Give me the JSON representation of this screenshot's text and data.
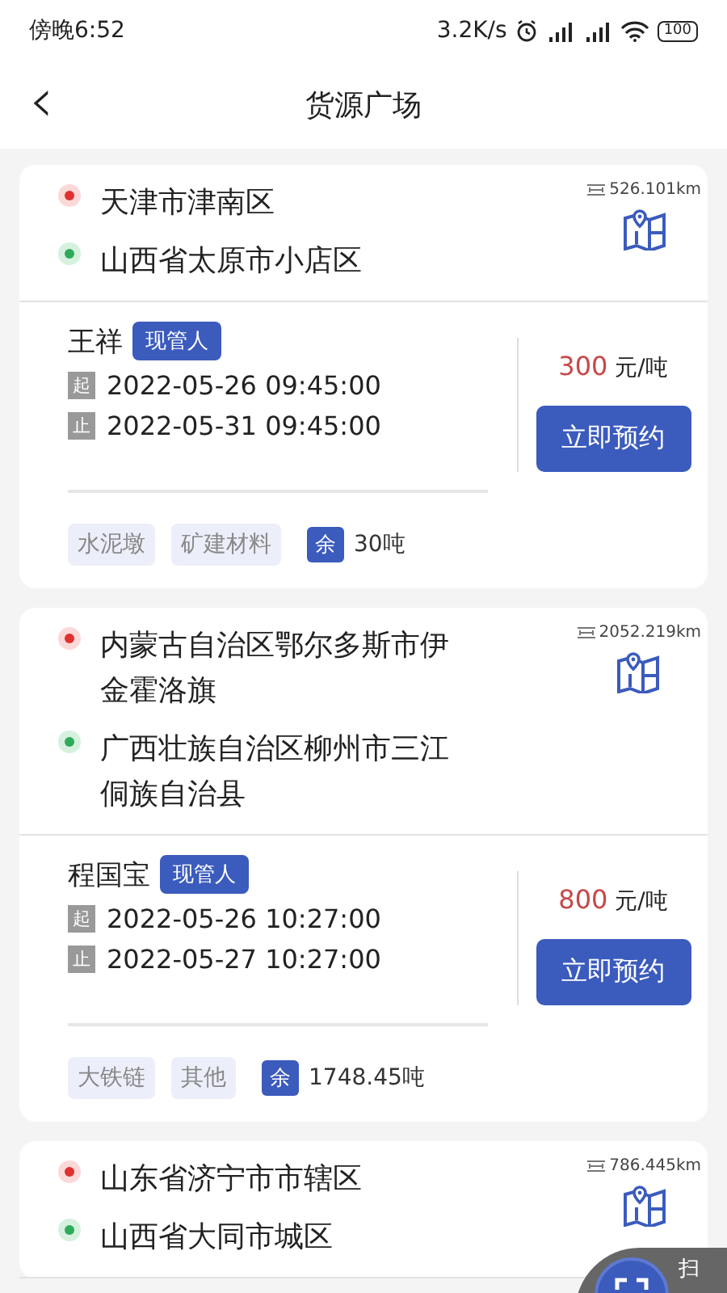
{
  "status_bar": {
    "time": "傍晚6:52",
    "speed": "3.2K/s",
    "battery": "100"
  },
  "header": {
    "back": "‹",
    "title": "货源广场"
  },
  "cards": [
    {
      "origin": "天津市津南区",
      "destination": "山西省太原市小店区",
      "distance": "526.101km",
      "name": "王祥",
      "role": "现管人",
      "start_label": "起",
      "start": "2022-05-26 09:45:00",
      "end_label": "止",
      "end": "2022-05-31 09:45:00",
      "price": "300",
      "price_unit": "元/吨",
      "button": "立即预约",
      "tags": [
        "水泥墩",
        "矿建材料"
      ],
      "remain_label": "余",
      "remain": "30吨"
    },
    {
      "origin": "内蒙古自治区鄂尔多斯市伊金霍洛旗",
      "destination": "广西壮族自治区柳州市三江侗族自治县",
      "distance": "2052.219km",
      "name": "程国宝",
      "role": "现管人",
      "start_label": "起",
      "start": "2022-05-26 10:27:00",
      "end_label": "止",
      "end": "2022-05-27 10:27:00",
      "price": "800",
      "price_unit": "元/吨",
      "button": "立即预约",
      "tags": [
        "大铁链",
        "其他"
      ],
      "remain_label": "余",
      "remain": "1748.45吨"
    },
    {
      "origin": "山东省济宁市市辖区",
      "destination": "山西省大同市城区",
      "distance": "786.445km"
    }
  ],
  "scan_button": {
    "label": "扫"
  }
}
